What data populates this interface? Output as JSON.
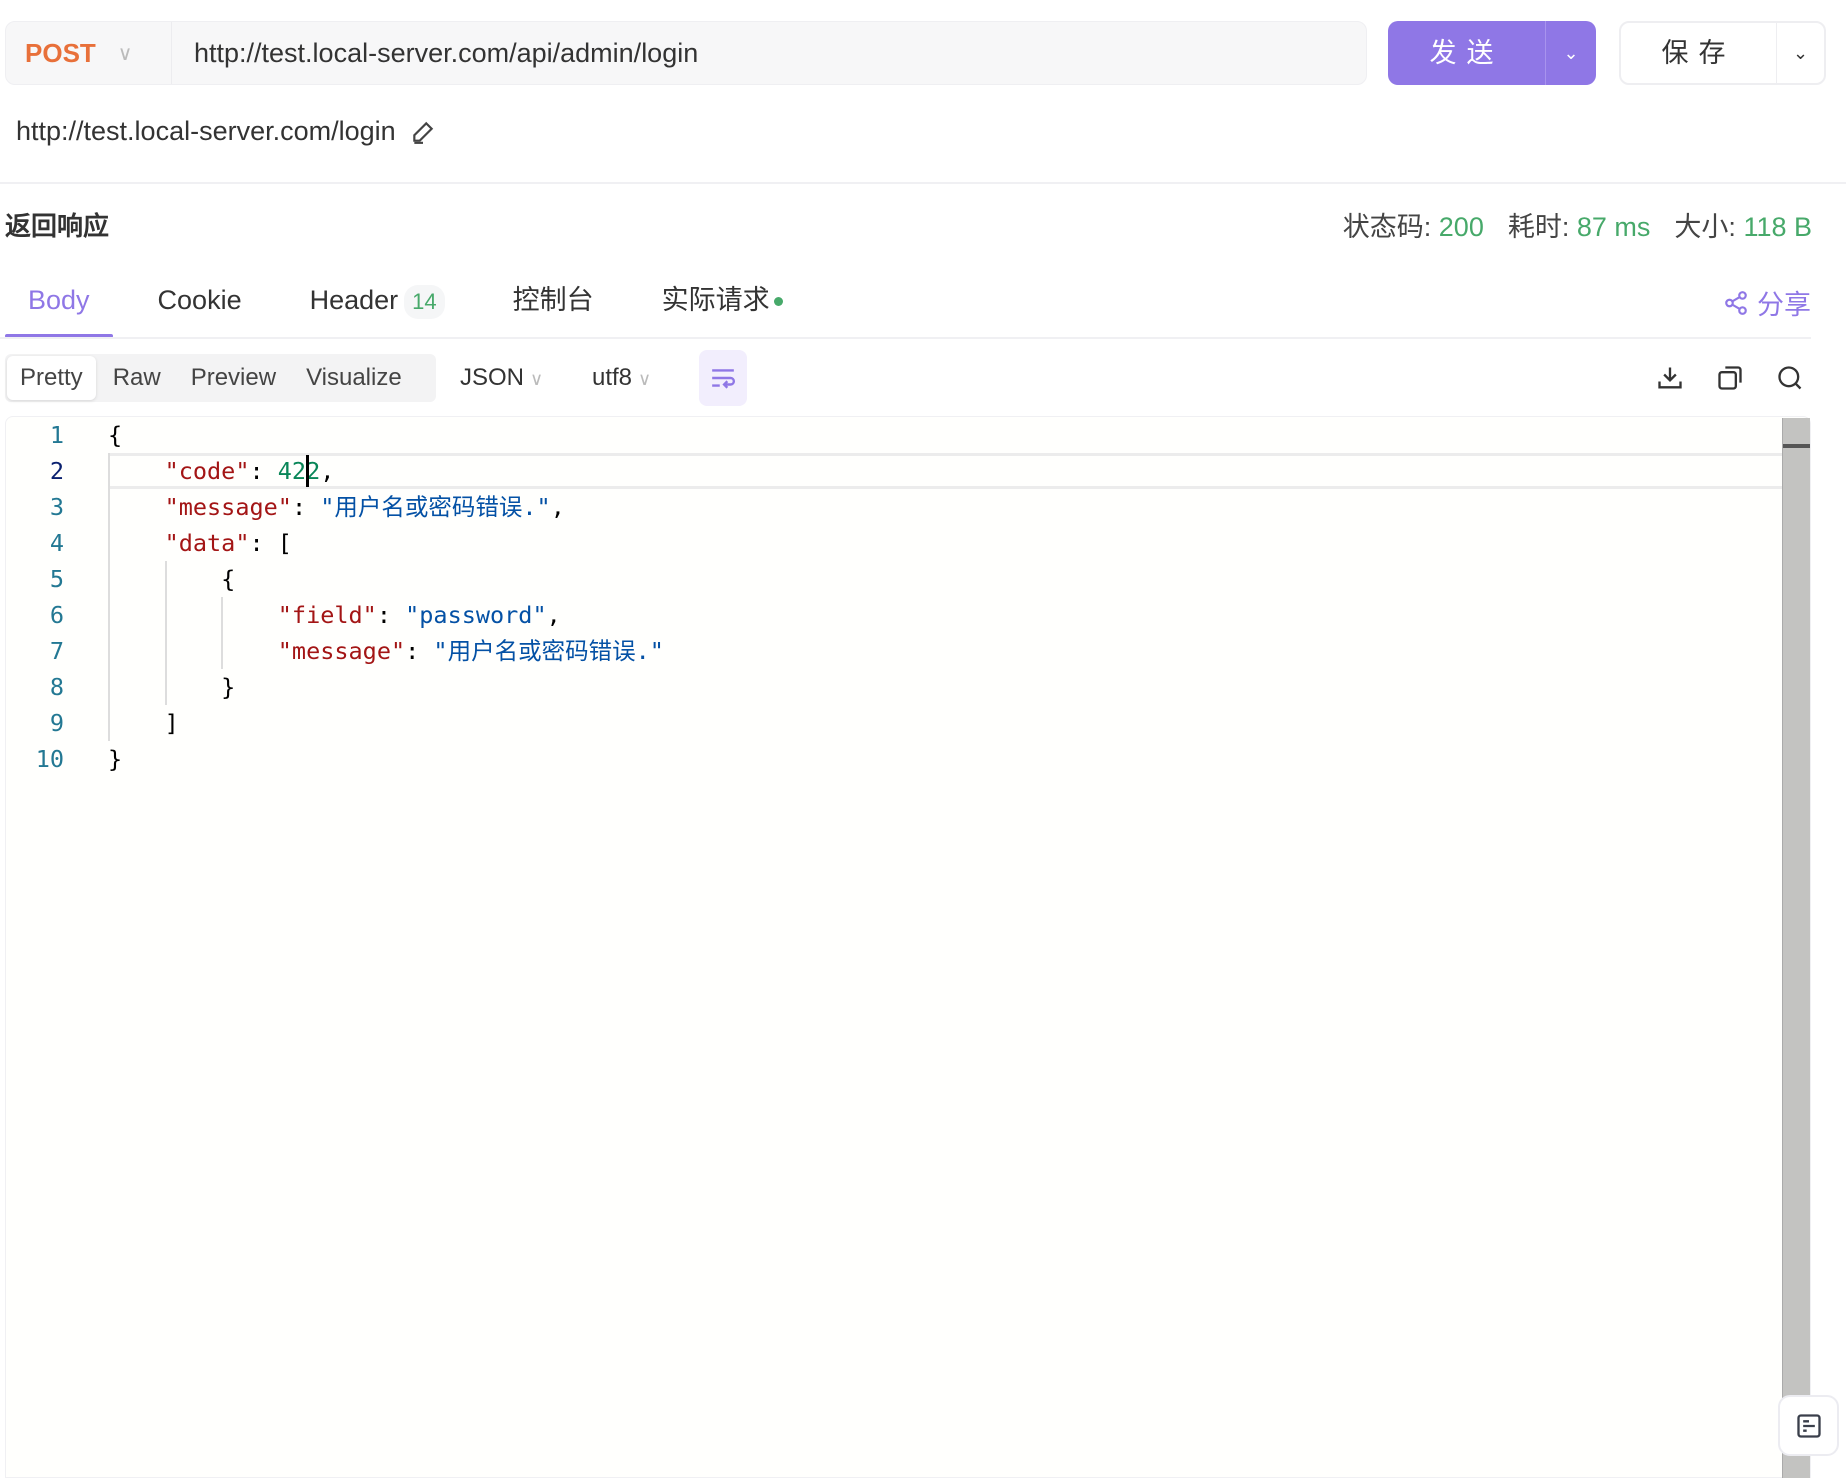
{
  "request": {
    "method": "POST",
    "url": "http://test.local-server.com/api/admin/login",
    "send_label": "发送",
    "save_label": "保存",
    "display_url": "http://test.local-server.com/login"
  },
  "response": {
    "title": "返回响应",
    "status_label": "状态码:",
    "status_value": "200",
    "time_label": "耗时:",
    "time_value": "87 ms",
    "size_label": "大小:",
    "size_value": "118 B"
  },
  "tabs": [
    {
      "label": "Body",
      "active": true
    },
    {
      "label": "Cookie"
    },
    {
      "label": "Header",
      "badge": "14"
    },
    {
      "label": "控制台"
    },
    {
      "label": "实际请求",
      "dot": true
    }
  ],
  "share_label": "分享",
  "view_modes": [
    "Pretty",
    "Raw",
    "Preview",
    "Visualize"
  ],
  "format": "JSON",
  "encoding": "utf8",
  "colors": {
    "accent": "#8f77e6",
    "method": "#e8703a",
    "success": "#47a96a"
  },
  "code_lines": [
    [
      [
        "p",
        "{"
      ]
    ],
    [
      [
        "p",
        "    "
      ],
      [
        "k",
        "\"code\""
      ],
      [
        "p",
        ": "
      ],
      [
        "n",
        "422"
      ],
      [
        "p",
        ","
      ]
    ],
    [
      [
        "p",
        "    "
      ],
      [
        "k",
        "\"message\""
      ],
      [
        "p",
        ": "
      ],
      [
        "s",
        "\"用户名或密码错误.\""
      ],
      [
        "p",
        ","
      ]
    ],
    [
      [
        "p",
        "    "
      ],
      [
        "k",
        "\"data\""
      ],
      [
        "p",
        ": ["
      ]
    ],
    [
      [
        "p",
        "        {"
      ]
    ],
    [
      [
        "p",
        "            "
      ],
      [
        "k",
        "\"field\""
      ],
      [
        "p",
        ": "
      ],
      [
        "s",
        "\"password\""
      ],
      [
        "p",
        ","
      ]
    ],
    [
      [
        "p",
        "            "
      ],
      [
        "k",
        "\"message\""
      ],
      [
        "p",
        ": "
      ],
      [
        "s",
        "\"用户名或密码错误.\""
      ]
    ],
    [
      [
        "p",
        "        }"
      ]
    ],
    [
      [
        "p",
        "    ]"
      ]
    ],
    [
      [
        "p",
        "}"
      ]
    ]
  ]
}
